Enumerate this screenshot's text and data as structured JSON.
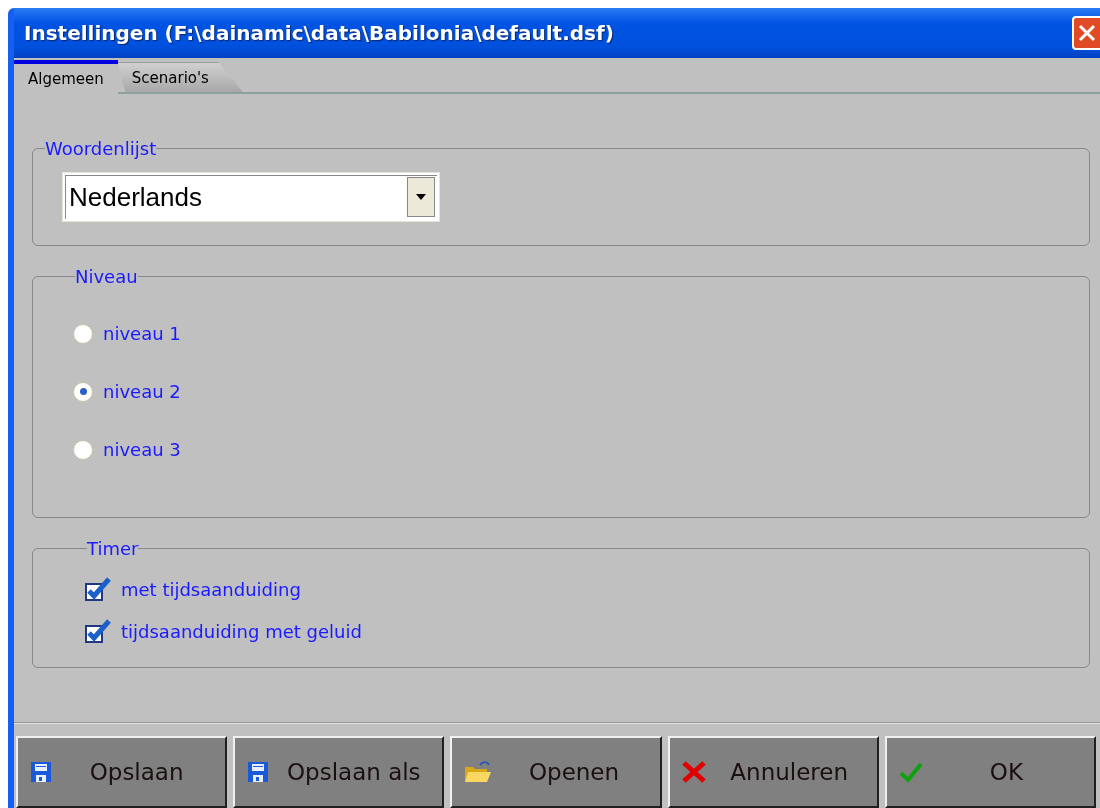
{
  "window": {
    "title": "Instellingen (F:\\dainamic\\data\\Babilonia\\default.dsf)"
  },
  "tabs": [
    {
      "label": "Algemeen",
      "selected": true
    },
    {
      "label": "Scenario's",
      "selected": false
    }
  ],
  "groups": [
    {
      "kind": "dropdown",
      "legend": "Woordenlijst",
      "value": "Nederlands"
    },
    {
      "kind": "radios",
      "legend": "Niveau",
      "options": [
        {
          "label": "niveau 1",
          "selected": false
        },
        {
          "label": "niveau 2",
          "selected": true
        },
        {
          "label": "niveau 3",
          "selected": false
        }
      ]
    },
    {
      "kind": "checkboxes",
      "legend": "Timer",
      "options": [
        {
          "label": "met tijdsaanduiding",
          "checked": true
        },
        {
          "label": "tijdsaanduiding met geluid",
          "checked": true
        }
      ]
    }
  ],
  "buttons": [
    {
      "kind": "save",
      "label": "Opslaan"
    },
    {
      "kind": "save",
      "label": "Opslaan als"
    },
    {
      "kind": "open",
      "label": "Openen"
    },
    {
      "kind": "cancel",
      "label": "Annuleren"
    },
    {
      "kind": "ok",
      "label": "OK"
    }
  ]
}
